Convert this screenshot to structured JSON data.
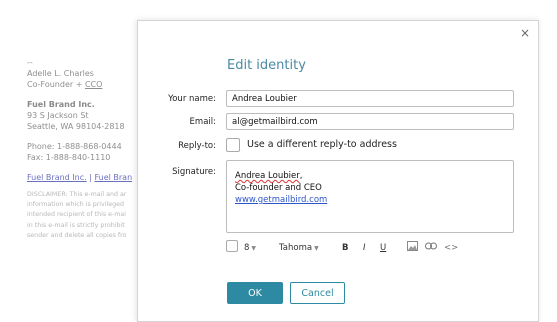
{
  "background_email": {
    "dashes": "--",
    "name": "Adelle L. Charles",
    "role_prefix": "Co-Founder + ",
    "role_suffix": "CCO",
    "company": "Fuel Brand Inc.",
    "address1": "93 S Jackson St",
    "address2": "Seattle, WA 98104-2818",
    "phone": "Phone: 1-888-868-0444",
    "fax": "Fax: 1-888-840-1110",
    "link1": "Fuel Brand Inc.",
    "link_sep": "|",
    "link2": "Fuel Bran",
    "disclaimer": [
      "DISCLAIMER: This e-mail and ar",
      "information which is privileged",
      "intended recipient of this e-mai",
      "in this e-mail is strictly prohibit",
      "sender and delete all copies fro"
    ]
  },
  "dialog": {
    "close_glyph": "×",
    "title": "Edit identity",
    "labels": {
      "name": "Your name:",
      "email": "Email:",
      "reply_to": "Reply-to:",
      "signature": "Signature:"
    },
    "values": {
      "name": "Andrea Loubier",
      "email": "al@getmailbird.com"
    },
    "reply_to_checkbox_label": "Use a different reply-to address",
    "reply_to_checked": false,
    "signature": {
      "line1_name": "Andrea Loubier",
      "line1_suffix": ",",
      "line2": "Co-founder and CEO",
      "line3_link": "www.getmailbird.com"
    },
    "toolbar": {
      "font_size": "8",
      "font_family": "Tahoma",
      "bold": "B",
      "italic": "I",
      "underline": "U",
      "link_icon": "link-icon",
      "code": "<>"
    },
    "buttons": {
      "ok": "OK",
      "cancel": "Cancel"
    },
    "colors": {
      "accent": "#2e8aa3",
      "title": "#4a8aa3",
      "link": "#2d55c8"
    }
  }
}
